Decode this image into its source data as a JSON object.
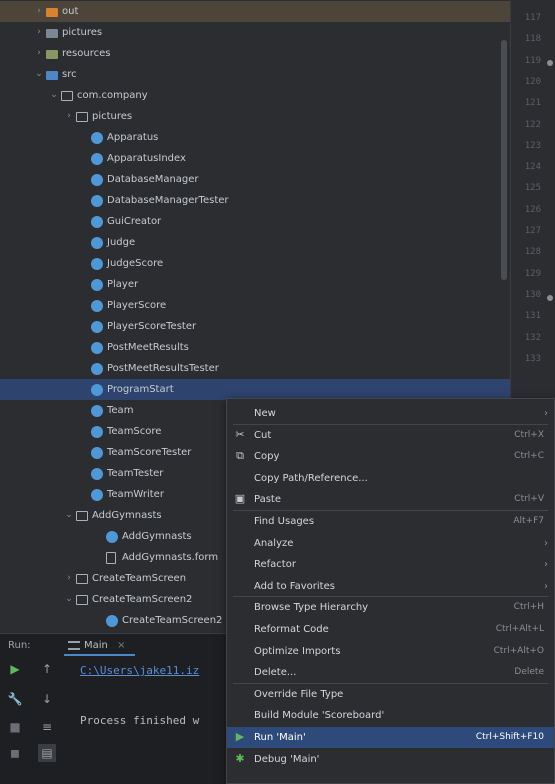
{
  "project_tree": {
    "items": [
      {
        "label": "out",
        "type": "folder-out",
        "level": 0,
        "expander": "closed"
      },
      {
        "label": "pictures",
        "type": "folder",
        "level": 0,
        "expander": "closed"
      },
      {
        "label": "resources",
        "type": "folder-res",
        "level": 0,
        "expander": "closed"
      },
      {
        "label": "src",
        "type": "folder-src",
        "level": 0,
        "expander": "open"
      },
      {
        "label": "com.company",
        "type": "package",
        "level": 1,
        "expander": "open"
      },
      {
        "label": "pictures",
        "type": "package",
        "level": 2,
        "expander": "closed"
      },
      {
        "label": "Apparatus",
        "type": "class",
        "level": 3
      },
      {
        "label": "ApparatusIndex",
        "type": "class",
        "level": 3
      },
      {
        "label": "DatabaseManager",
        "type": "class",
        "level": 3
      },
      {
        "label": "DatabaseManagerTester",
        "type": "class",
        "level": 3
      },
      {
        "label": "GuiCreator",
        "type": "class",
        "level": 3
      },
      {
        "label": "Judge",
        "type": "class",
        "level": 3
      },
      {
        "label": "JudgeScore",
        "type": "class",
        "level": 3
      },
      {
        "label": "Player",
        "type": "class",
        "level": 3
      },
      {
        "label": "PlayerScore",
        "type": "class",
        "level": 3
      },
      {
        "label": "PlayerScoreTester",
        "type": "class",
        "level": 3
      },
      {
        "label": "PostMeetResults",
        "type": "class",
        "level": 3
      },
      {
        "label": "PostMeetResultsTester",
        "type": "class",
        "level": 3
      },
      {
        "label": "ProgramStart",
        "type": "class",
        "level": 3,
        "selected": true
      },
      {
        "label": "Team",
        "type": "class",
        "level": 3
      },
      {
        "label": "TeamScore",
        "type": "class",
        "level": 3
      },
      {
        "label": "TeamScoreTester",
        "type": "class",
        "level": 3
      },
      {
        "label": "TeamTester",
        "type": "class",
        "level": 3
      },
      {
        "label": "TeamWriter",
        "type": "class",
        "level": 3
      },
      {
        "label": "AddGymnasts",
        "type": "package",
        "level": 2,
        "expander": "open"
      },
      {
        "label": "AddGymnasts",
        "type": "class",
        "level": 4
      },
      {
        "label": "AddGymnasts.form",
        "type": "file",
        "level": 4
      },
      {
        "label": "CreateTeamScreen",
        "type": "package",
        "level": 2,
        "expander": "closed"
      },
      {
        "label": "CreateTeamScreen2",
        "type": "package",
        "level": 2,
        "expander": "open"
      },
      {
        "label": "CreateTeamScreen2",
        "type": "class",
        "level": 4
      }
    ]
  },
  "gutter": {
    "line_numbers": [
      "117",
      "118",
      "119",
      "120",
      "121",
      "122",
      "123",
      "124",
      "125",
      "126",
      "127",
      "128",
      "129",
      "130",
      "131",
      "132",
      "133"
    ]
  },
  "context_menu": {
    "items": [
      {
        "label": "New",
        "shortcut": "",
        "submenu": true,
        "icon": ""
      },
      {
        "label": "Cut",
        "shortcut": "Ctrl+X",
        "submenu": false,
        "icon": "scissors-icon"
      },
      {
        "label": "Copy",
        "shortcut": "Ctrl+C",
        "submenu": false,
        "icon": "copy-icon"
      },
      {
        "label": "Copy Path/Reference...",
        "shortcut": "",
        "submenu": false,
        "icon": ""
      },
      {
        "label": "Paste",
        "shortcut": "Ctrl+V",
        "submenu": false,
        "icon": "clipboard-icon"
      },
      {
        "label": "Find Usages",
        "shortcut": "Alt+F7",
        "submenu": false,
        "icon": ""
      },
      {
        "label": "Analyze",
        "shortcut": "",
        "submenu": true,
        "icon": ""
      },
      {
        "label": "Refactor",
        "shortcut": "",
        "submenu": true,
        "icon": ""
      },
      {
        "label": "Add to Favorites",
        "shortcut": "",
        "submenu": true,
        "icon": ""
      },
      {
        "label": "Browse Type Hierarchy",
        "shortcut": "Ctrl+H",
        "submenu": false,
        "icon": ""
      },
      {
        "label": "Reformat Code",
        "shortcut": "Ctrl+Alt+L",
        "submenu": false,
        "icon": ""
      },
      {
        "label": "Optimize Imports",
        "shortcut": "Ctrl+Alt+O",
        "submenu": false,
        "icon": ""
      },
      {
        "label": "Delete...",
        "shortcut": "Delete",
        "submenu": false,
        "icon": ""
      },
      {
        "label": "Override File Type",
        "shortcut": "",
        "submenu": false,
        "icon": ""
      },
      {
        "label": "Build Module 'Scoreboard'",
        "shortcut": "",
        "submenu": false,
        "icon": ""
      },
      {
        "label": "Run 'Main'",
        "shortcut": "Ctrl+Shift+F10",
        "submenu": false,
        "icon": "run-icon",
        "active": true
      },
      {
        "label": "Debug 'Main'",
        "shortcut": "",
        "submenu": false,
        "icon": "debug-icon"
      }
    ]
  },
  "run_panel": {
    "label": "Run:",
    "tab_label": "Main",
    "command_line": "C:\\Users\\jake11.iz",
    "process_text": "Process finished w"
  },
  "colors": {
    "selection": "#2e436e",
    "menu_active": "#2e4a7a",
    "class_icon": "#4f98d8",
    "link": "#5a8fd6"
  }
}
